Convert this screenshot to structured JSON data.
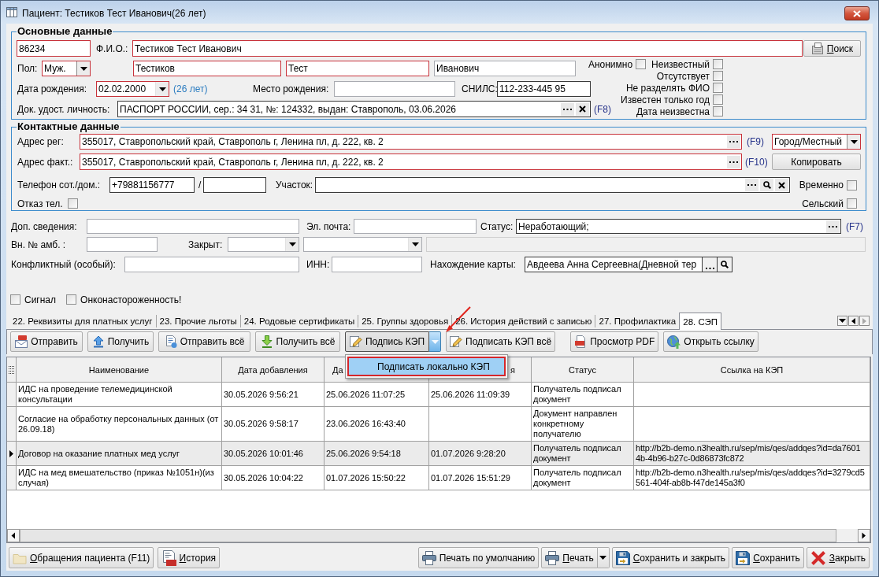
{
  "window": {
    "title": "Пациент: Тестиков Тест Иванович(26 лет)"
  },
  "main_data": {
    "legend": "Основные данные",
    "card_number": {
      "value": "86234",
      "required": true
    },
    "fio_label": "Ф.И.О.:",
    "fio": {
      "value": "Тестиков Тест Иванович",
      "required": true
    },
    "search_button": {
      "label": "Поиск",
      "mnemonic": true
    },
    "sex_label": "Пол:",
    "sex": {
      "value": "Муж.",
      "required": true
    },
    "last_name": {
      "value": "Тестиков",
      "required": true
    },
    "first_name": {
      "value": "Тест",
      "required": true
    },
    "patronymic": {
      "value": "Иванович",
      "required": false
    },
    "birth_date_label": "Дата рождения:",
    "birth_date": {
      "value": "02.02.2000",
      "required": true
    },
    "age": "(26 лет)",
    "birth_place_label": "Место рождения:",
    "birth_place": {
      "required": false
    },
    "snils_label": "СНИЛС:",
    "snils": {
      "value": "112-233-445 95",
      "required": false
    },
    "document_label": "Док. удост. личность:",
    "document": {
      "value": "ПАСПОРТ РОССИИ, сер.: 34 31, №: 124332, выдан: Ставрополь, 03.06.2026",
      "required": false
    },
    "document_hotkey": "(F8)",
    "flags": [
      {
        "label": "Анонимно",
        "checked": false
      },
      {
        "label": "Неизвестный",
        "checked": false
      },
      {
        "label": "Отсутствует",
        "checked": false
      },
      {
        "label": "Не разделять ФИО",
        "checked": false
      },
      {
        "label": "Известен только год",
        "checked": false
      },
      {
        "label": "Дата неизвестна",
        "checked": false
      }
    ]
  },
  "contacts": {
    "legend": "Контактные данные",
    "reg_address_label": "Адрес рег:",
    "reg_address": {
      "value": "355017, Ставропольский край, Ставрополь г, Ленина пл, д. 222, кв. 2",
      "required": true
    },
    "reg_address_hotkey": "(F9)",
    "locality": {
      "value": "Город/Местный",
      "required": true
    },
    "fact_address_label": "Адрес факт.:",
    "fact_address": {
      "value": "355017, Ставропольский край, Ставрополь г, Ленина пл, д. 222, кв. 2",
      "required": true
    },
    "fact_address_hotkey": "(F10)",
    "copy_button": {
      "label": "Копировать",
      "mnemonic": false
    },
    "phone_label": "Телефон сот./дом.:",
    "mobile_phone": {
      "value": "+79881156777",
      "required": false
    },
    "phone_separator": "/",
    "home_phone": {
      "required": false
    },
    "district_label": "Участок:",
    "district": {
      "required": false
    },
    "temporary": {
      "label": "Временно",
      "checked": false
    },
    "phone_refusal": {
      "label": "Отказ тел.",
      "checked": false
    },
    "rural": {
      "label": "Сельский",
      "checked": false
    }
  },
  "extra": {
    "additional_info_label": "Доп. сведения:",
    "additional_info": {
      "required": false
    },
    "email_label": "Эл. почта:",
    "email": {
      "required": false
    },
    "status_label": "Статус:",
    "status": {
      "value": "Неработающий;",
      "required": false
    },
    "status_hotkey": "(F7)",
    "outpatient_number_label": "Вн. № амб. :",
    "outpatient_number": {
      "required": false
    },
    "closed_label": "Закрыт:",
    "closed_value_1": {
      "required": false
    },
    "closed_value_2": {
      "required": false
    },
    "closed_value_3": {
      "required": false,
      "disabled": true
    },
    "conflict_label": "Конфликтный (особый):",
    "conflict": {
      "required": false
    },
    "inn_label": "ИНН:",
    "inn": {
      "required": false
    },
    "card_location_label": "Нахождение карты:",
    "card_location": {
      "value": "Авдеева Анна Сергеевна(Дневной тер",
      "required": false
    },
    "flags": [
      {
        "label": "Сигнал",
        "checked": false
      },
      {
        "label": "Онконастороженность!",
        "checked": false
      }
    ]
  },
  "tabs": [
    {
      "label": "22. Реквизиты для платных услуг",
      "selected": false
    },
    {
      "label": "23. Прочие льготы",
      "selected": false
    },
    {
      "label": "24. Родовые сертификаты",
      "selected": false
    },
    {
      "label": "25. Группы здоровья",
      "selected": false
    },
    {
      "label": "26. История действий с записью",
      "selected": false
    },
    {
      "label": "27. Профилактика",
      "selected": false
    },
    {
      "label": "28. СЭП",
      "selected": true
    }
  ],
  "tab_scroll": {
    "left_enabled": true,
    "right_enabled": false
  },
  "toolbar": {
    "groups": [
      [
        {
          "kind": "send",
          "label": "Отправить",
          "split": false
        },
        {
          "kind": "receive",
          "label": "Получить",
          "split": false
        },
        {
          "kind": "send_all",
          "label": "Отправить всё",
          "split": false
        },
        {
          "kind": "receive_all",
          "label": "Получить всё",
          "split": false
        },
        {
          "kind": "sign",
          "label": "Подпись КЭП",
          "split": true,
          "menu_open": true,
          "menu": [
            {
              "label": "Подписать локально КЭП",
              "selected": true
            }
          ]
        },
        {
          "kind": "sign_all",
          "label": "Подписать КЭП всё",
          "split": false
        }
      ],
      [
        {
          "kind": "pdf",
          "label": "Просмотр PDF",
          "split": false
        },
        {
          "kind": "link",
          "label": "Открыть ссылку",
          "split": false
        }
      ]
    ]
  },
  "grid": {
    "columns": [
      "Наименование",
      "Дата добавления",
      "Да",
      "я",
      "Статус",
      "Ссылка на КЭП"
    ],
    "rows": [
      {
        "selected": false,
        "name": "ИДС на проведение телемедицинской консультации",
        "date_added": "30.05.2026 9:56:21",
        "column_3": "25.06.2026 11:07:25",
        "column_4": "25.06.2026 11:09:39",
        "status": "Получатель подписал документ"
      },
      {
        "selected": false,
        "name": "Согласие на обработку персональных данных (от 26.09.18)",
        "date_added": "30.05.2026 9:58:17",
        "column_3": "23.06.2026 16:43:40",
        "status": "Документ направлен конкретному получателю"
      },
      {
        "selected": true,
        "name": "Договор на оказание платных мед услуг",
        "date_added": "30.05.2026 10:01:46",
        "column_3": "25.06.2026 9:54:18",
        "column_4": "01.07.2026 9:28:20",
        "status": "Получатель подписал документ",
        "link": [
          "http://b2b-demo.n3health.ru/sep/mis/qes/addqes?id=da7601",
          "4b-4b96-b27c-0d86873fc872"
        ]
      },
      {
        "selected": false,
        "name": "ИДС на мед вмешательство (приказ №1051н)(из случая)",
        "date_added": "30.05.2026 10:04:22",
        "column_3": "01.07.2026 15:50:22",
        "column_4": "01.07.2026 15:51:29",
        "status": "Получатель подписал документ",
        "link": [
          "http://b2b-demo.n3health.ru/sep/mis/qes/addqes?id=3279cd5",
          "561-404f-ab8b-f47de145a3f0"
        ]
      }
    ]
  },
  "bottom_bar": {
    "left": [
      {
        "kind": "visits",
        "label": "Обращения пациента (F11)",
        "mnemonic": true,
        "split": false
      },
      {
        "kind": "history",
        "label": "История",
        "mnemonic": true,
        "split": false
      }
    ],
    "right": [
      {
        "kind": "print_default",
        "label": "Печать по умолчанию",
        "mnemonic": false,
        "split": false
      },
      {
        "kind": "print",
        "label": "Печать",
        "mnemonic": true,
        "split": true,
        "menu_open": false
      },
      {
        "kind": "save_close",
        "label": "Сохранить и закрыть",
        "mnemonic": true,
        "split": false
      },
      {
        "kind": "save",
        "label": "Сохранить",
        "mnemonic": true,
        "split": false
      },
      {
        "kind": "close",
        "label": "Закрыть",
        "mnemonic": true,
        "split": false
      }
    ]
  }
}
